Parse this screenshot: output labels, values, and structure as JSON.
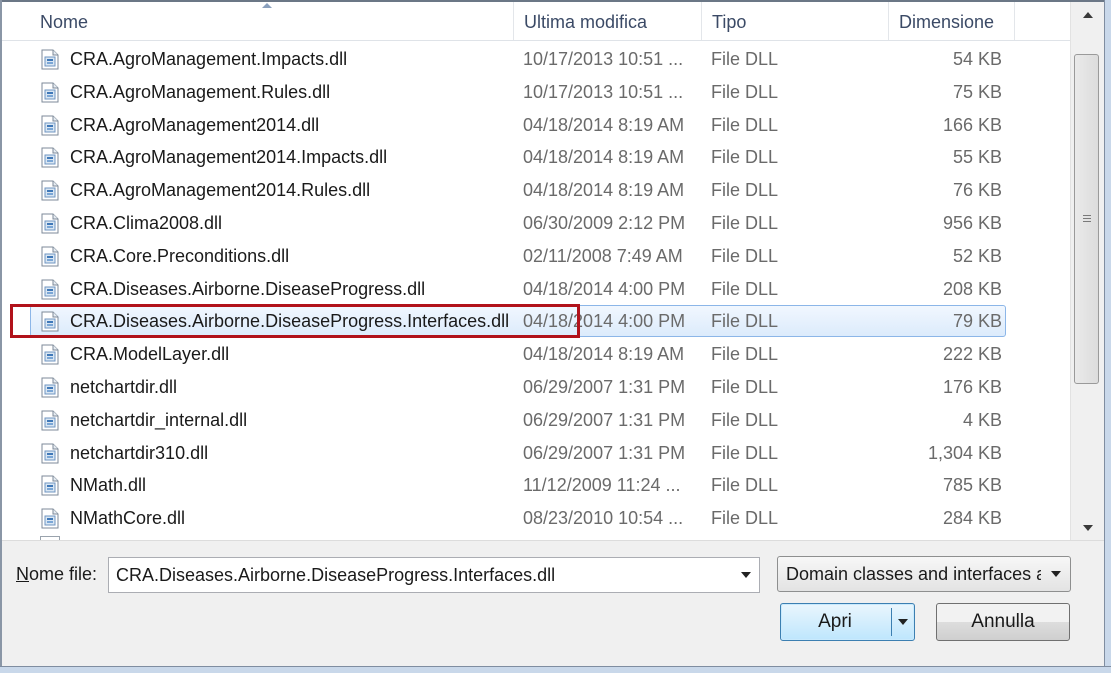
{
  "columns": {
    "name": "Nome",
    "modified": "Ultima modifica",
    "type": "Tipo",
    "size": "Dimensione"
  },
  "files": [
    {
      "name": "CRA.AgroManagement.Impacts.dll",
      "modified": "10/17/2013 10:51 ...",
      "type": "File DLL",
      "size": "54 KB"
    },
    {
      "name": "CRA.AgroManagement.Rules.dll",
      "modified": "10/17/2013 10:51 ...",
      "type": "File DLL",
      "size": "75 KB"
    },
    {
      "name": "CRA.AgroManagement2014.dll",
      "modified": "04/18/2014 8:19 AM",
      "type": "File DLL",
      "size": "166 KB"
    },
    {
      "name": "CRA.AgroManagement2014.Impacts.dll",
      "modified": "04/18/2014 8:19 AM",
      "type": "File DLL",
      "size": "55 KB"
    },
    {
      "name": "CRA.AgroManagement2014.Rules.dll",
      "modified": "04/18/2014 8:19 AM",
      "type": "File DLL",
      "size": "76 KB"
    },
    {
      "name": "CRA.Clima2008.dll",
      "modified": "06/30/2009 2:12 PM",
      "type": "File DLL",
      "size": "956 KB"
    },
    {
      "name": "CRA.Core.Preconditions.dll",
      "modified": "02/11/2008 7:49 AM",
      "type": "File DLL",
      "size": "52 KB"
    },
    {
      "name": "CRA.Diseases.Airborne.DiseaseProgress.dll",
      "modified": "04/18/2014 4:00 PM",
      "type": "File DLL",
      "size": "208 KB"
    },
    {
      "name": "CRA.Diseases.Airborne.DiseaseProgress.Interfaces.dll",
      "modified": "04/18/2014 4:00 PM",
      "type": "File DLL",
      "size": "79 KB",
      "selected": true
    },
    {
      "name": "CRA.ModelLayer.dll",
      "modified": "04/18/2014 8:19 AM",
      "type": "File DLL",
      "size": "222 KB"
    },
    {
      "name": "netchartdir.dll",
      "modified": "06/29/2007 1:31 PM",
      "type": "File DLL",
      "size": "176 KB"
    },
    {
      "name": "netchartdir_internal.dll",
      "modified": "06/29/2007 1:31 PM",
      "type": "File DLL",
      "size": "4 KB"
    },
    {
      "name": "netchartdir310.dll",
      "modified": "06/29/2007 1:31 PM",
      "type": "File DLL",
      "size": "1,304 KB"
    },
    {
      "name": "NMath.dll",
      "modified": "11/12/2009 11:24 ...",
      "type": "File DLL",
      "size": "785 KB"
    },
    {
      "name": "NMathCore.dll",
      "modified": "08/23/2010 10:54 ...",
      "type": "File DLL",
      "size": "284 KB"
    }
  ],
  "file_name": {
    "label_underlined": "N",
    "label_rest": "ome file:",
    "value": "CRA.Diseases.Airborne.DiseaseProgress.Interfaces.dll"
  },
  "filter": {
    "selected": "Domain classes and interfaces a"
  },
  "buttons": {
    "open": "Apri",
    "cancel": "Annulla"
  },
  "colors": {
    "selection": "#dcebfc",
    "highlight_box": "#b1121a",
    "header_text": "#3b4a66"
  },
  "icons": {
    "file": "dll-file-icon",
    "sort": "sort-ascending-icon"
  }
}
